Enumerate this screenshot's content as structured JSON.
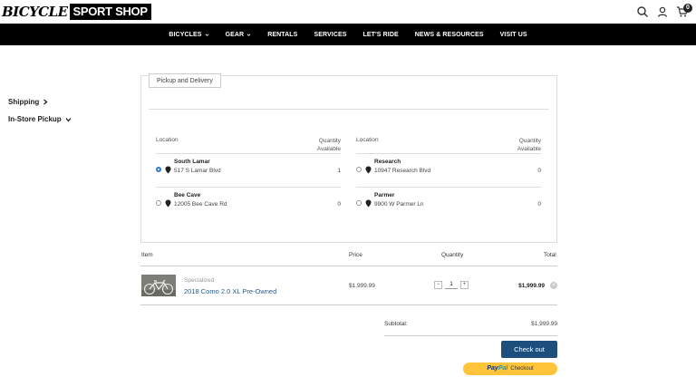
{
  "header": {
    "logo_left": "BICYCLE",
    "logo_right": "SPORT SHOP",
    "cart_count": "0"
  },
  "nav": {
    "items": [
      {
        "label": "BICYCLES",
        "has_caret": true
      },
      {
        "label": "GEAR",
        "has_caret": true
      },
      {
        "label": "RENTALS"
      },
      {
        "label": "SERVICES"
      },
      {
        "label": "LET'S RIDE"
      },
      {
        "label": "NEWS & RESOURCES"
      },
      {
        "label": "VISIT US"
      }
    ]
  },
  "fulfillment": {
    "tab_label": "Pickup and Delivery",
    "shipping_label": "Shipping",
    "instore_label": "In-Store Pickup",
    "location_header": "Location",
    "quantity_header_1": "Quantity",
    "quantity_header_2": "Available",
    "locations": [
      {
        "name": "South Lamar",
        "address": "517 S Lamar Blvd",
        "qty": "1",
        "selected": true
      },
      {
        "name": "Research",
        "address": "10947 Research Blvd",
        "qty": "0",
        "selected": false
      },
      {
        "name": "Bee Cave",
        "address": "12005 Bee Cave Rd",
        "qty": "0",
        "selected": false
      },
      {
        "name": "Parmer",
        "address": "9900 W Parmer Ln",
        "qty": "0",
        "selected": false
      }
    ]
  },
  "cart": {
    "headers": {
      "item": "Item",
      "price": "Price",
      "quantity": "Quantity",
      "total": "Total"
    },
    "line": {
      "brand": "Specialized",
      "product": "2018 Como 2.0 XL Pre-Owned",
      "price": "$1,999.99",
      "qty": "1",
      "total": "$1,999.99",
      "minus": "−",
      "plus": "+",
      "remove": "×"
    },
    "subtotal_label": "Subtotal:",
    "subtotal_value": "$1,999.99",
    "checkout_label": "Check out",
    "paypal_a": "Pay",
    "paypal_b": "Pal",
    "paypal_c": "Checkout"
  },
  "colors": {
    "nav_bg": "#000000",
    "link": "#2b5d8e",
    "checkout_bg": "#1d4f7c",
    "paypal_bg": "#ffc439",
    "radio_selected": "#2e7bd6"
  }
}
